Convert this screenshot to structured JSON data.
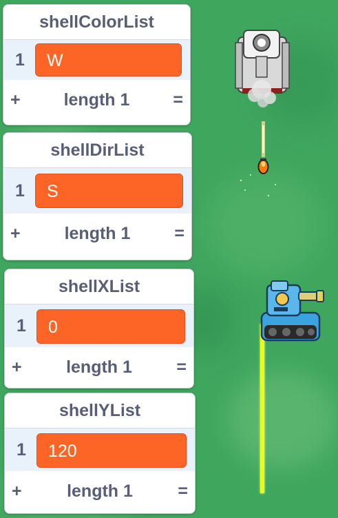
{
  "monitors": [
    {
      "name": "shellColorList",
      "index": "1",
      "value": "W",
      "footer": {
        "add": "+",
        "length": "length 1",
        "resize": "="
      }
    },
    {
      "name": "shellDirList",
      "index": "1",
      "value": "S",
      "footer": {
        "add": "+",
        "length": "length 1",
        "resize": "="
      }
    },
    {
      "name": "shellXList",
      "index": "1",
      "value": "0",
      "footer": {
        "add": "+",
        "length": "length 1",
        "resize": "="
      }
    },
    {
      "name": "shellYList",
      "index": "1",
      "value": "120",
      "footer": {
        "add": "+",
        "length": "length 1",
        "resize": "="
      }
    }
  ],
  "colors": {
    "background": "#3fa65e",
    "cell": "#fd6527",
    "monitor_text": "#575e75",
    "laser": "#e6ff1e",
    "player_tank": "#3aa3e0",
    "enemy_tank": "#ececec"
  },
  "sprites": [
    "enemy-tank",
    "enemy-shell",
    "player-tank",
    "aim-laser"
  ]
}
